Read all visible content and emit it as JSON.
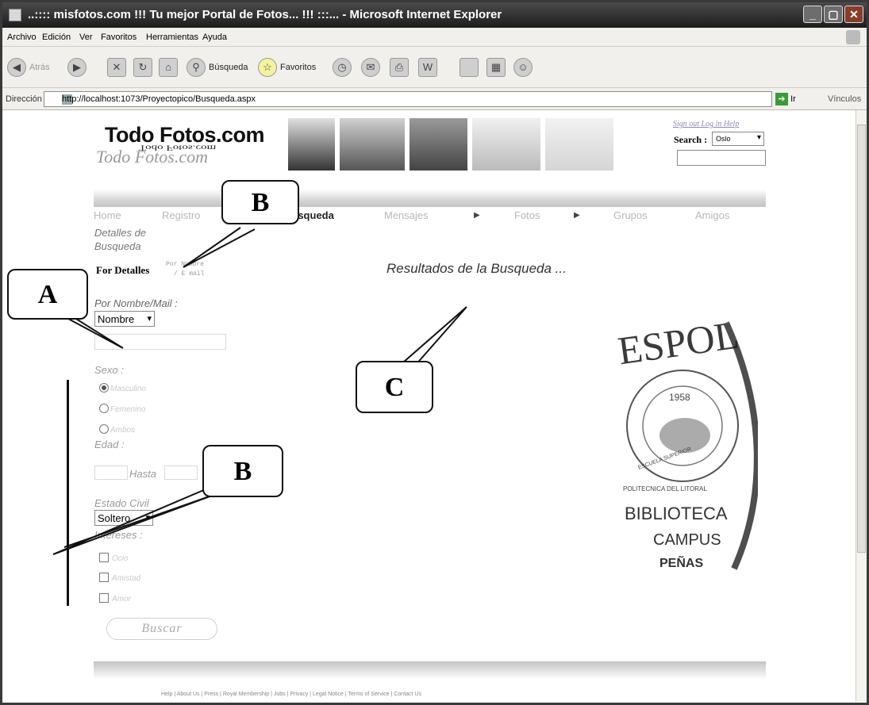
{
  "window": {
    "title": "..:::: misfotos.com !!! Tu mejor Portal de Fotos... !!! :::... - Microsoft Internet Explorer",
    "buttons": [
      "_",
      "▢",
      "✕"
    ]
  },
  "menu": [
    "Archivo",
    "Edición",
    "Ver",
    "Favoritos",
    "Herramientas",
    "Ayuda"
  ],
  "toolbar": {
    "back": "Atrás",
    "search": "Búsqueda",
    "favorites": "Favoritos"
  },
  "address": {
    "label": "Dirección",
    "url": "http://localhost:1073/Proyectopico/Busqueda.aspx",
    "go": "Ir",
    "links": "Vínculos"
  },
  "site": {
    "logo_main": "Todo Fotos.com",
    "logo_echo": "Todo Fotos.com",
    "logo_shadow": "Todo Fotos.com",
    "top_links": "Sign out Log in Help",
    "search_label": "Search :",
    "search_option": "Oslo"
  },
  "nav": [
    "Home",
    "Registro",
    "Busqueda",
    "Mensajes",
    "Fotos",
    "Grupos",
    "Amigos"
  ],
  "left": {
    "details_title_1": "Detalles de",
    "details_title_2": "Busqueda",
    "por_detalles": "For Detalles",
    "por_nombre_small_1": "Por Nombre",
    "por_nombre_small_2": "/ E mail",
    "por_nombre_mail": "Por Nombre/Mail :",
    "select_nombre": "Nombre",
    "sexo": "Sexo :",
    "masculino": "Masculino",
    "femenino": "Femenino",
    "ambos": "Ambos",
    "edad": "Edad :",
    "hasta": "Hasta",
    "estado_civil": "Estado Civil",
    "select_estado": "Soltero",
    "intereses": "Intereses :",
    "int1": "Ocio",
    "int2": "Amistad",
    "int3": "Amor",
    "buscar": "Buscar"
  },
  "main": {
    "results_title": "Resultados de la Busqueda ..."
  },
  "stamp": {
    "top": "ESPOL",
    "year": "1958",
    "ring_left": "ESCUELA SUPERIOR",
    "ring_right": "POLITECNICA DEL LITORAL",
    "line1": "BIBLIOTECA",
    "line2": "CAMPUS",
    "line3": "PEÑAS"
  },
  "callouts": {
    "a": "A",
    "b1": "B",
    "b2": "B",
    "c": "C"
  },
  "footer": "Help | About Us | Press | Royal Membership | Jobs | Privacy | Legal Notice | Terms of Service | Contact Us"
}
